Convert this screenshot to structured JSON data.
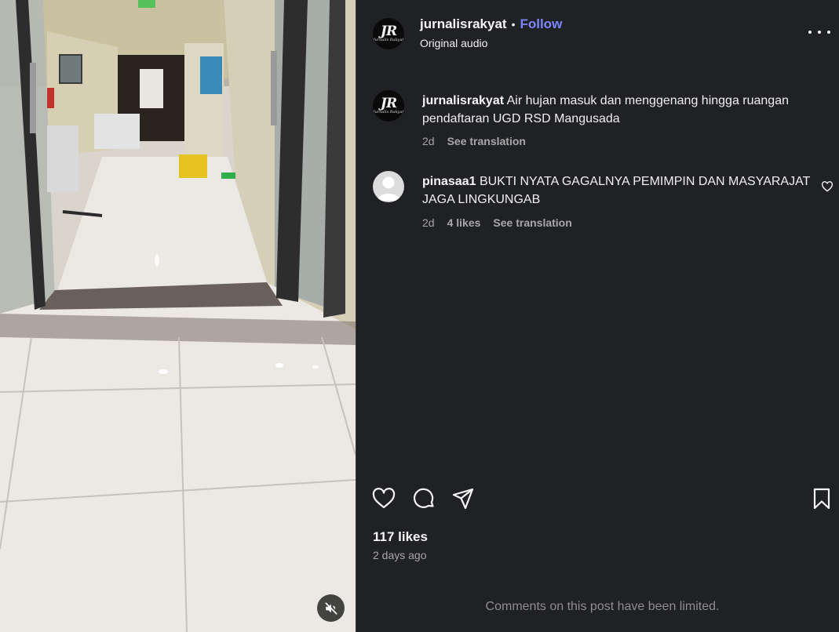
{
  "post": {
    "username": "jurnalisrakyat",
    "follow_label": "Follow",
    "audio_label": "Original audio",
    "avatar_letters": "JR",
    "avatar_script": "Jurnalis Rakyat"
  },
  "caption": {
    "username": "jurnalisrakyat",
    "text": "Air hujan masuk dan menggenang hingga ruangan pendaftaran UGD RSD Mangusada",
    "time": "2d",
    "translate_label": "See translation"
  },
  "comments": [
    {
      "username": "pinasaa1",
      "text": "BUKTI NYATA GAGALNYA PEMIMPIN DAN MASYARAJAT JAGA LINGKUNGAB",
      "time": "2d",
      "likes": "4 likes",
      "translate_label": "See translation"
    }
  ],
  "stats": {
    "likes": "117 likes",
    "time_ago": "2 days ago"
  },
  "footer": {
    "limited_text": "Comments on this post have been limited."
  },
  "icons": {
    "like": "heart-icon",
    "comment": "comment-bubble-icon",
    "share": "paper-plane-icon",
    "save": "bookmark-icon",
    "mute": "speaker-muted-icon",
    "more": "more-options-icon"
  },
  "colors": {
    "panel_bg": "#202124",
    "link_blue": "#7c86ff",
    "muted_text": "#a8a8a8"
  }
}
